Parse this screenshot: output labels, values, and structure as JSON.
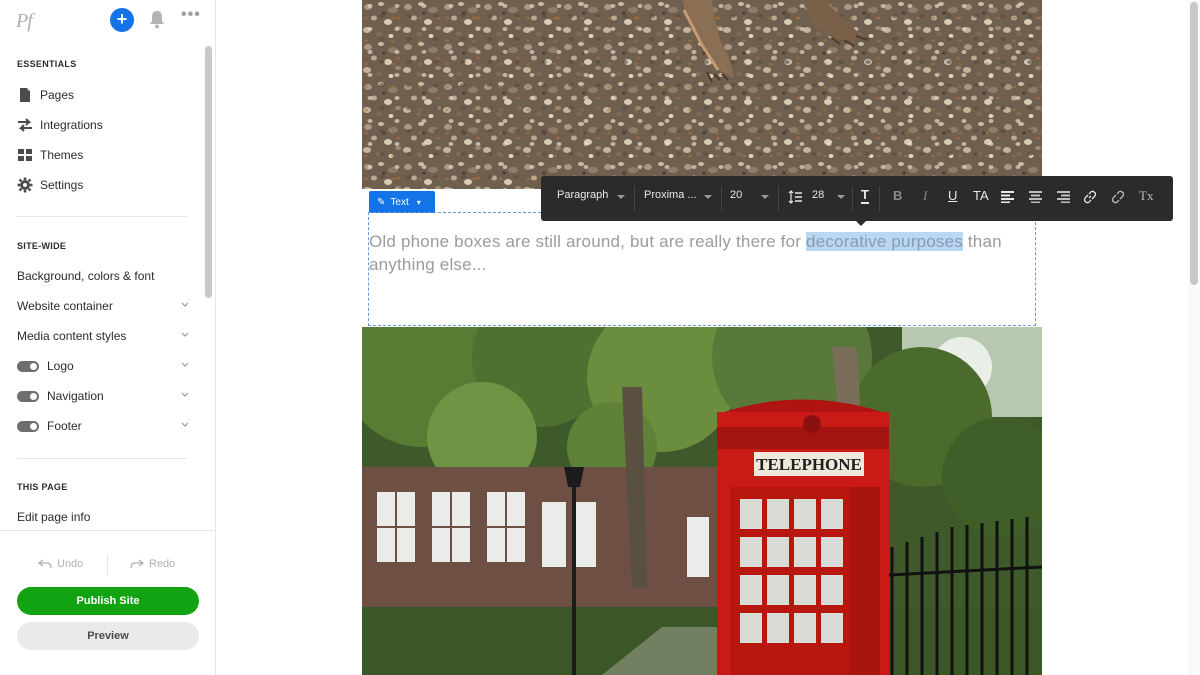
{
  "app": {
    "logo": "Pf"
  },
  "sidebar": {
    "sections": {
      "essentials": "ESSENTIALS",
      "site_wide": "SITE-WIDE",
      "this_page": "THIS PAGE"
    },
    "essentials": [
      {
        "label": "Pages",
        "icon": "page-icon"
      },
      {
        "label": "Integrations",
        "icon": "arrows-icon"
      },
      {
        "label": "Themes",
        "icon": "grid-icon"
      },
      {
        "label": "Settings",
        "icon": "gear-icon"
      }
    ],
    "site_wide": [
      {
        "label": "Background, colors & font"
      },
      {
        "label": "Website container"
      },
      {
        "label": "Media content styles"
      },
      {
        "label": "Logo",
        "toggle": "on"
      },
      {
        "label": "Navigation",
        "toggle": "on"
      },
      {
        "label": "Footer",
        "toggle": "on"
      }
    ],
    "this_page": [
      {
        "label": "Edit page info"
      }
    ],
    "undo": "Undo",
    "redo": "Redo",
    "publish": "Publish Site",
    "preview": "Preview"
  },
  "editor": {
    "block_tag": "Text",
    "body_plain_1": "Old phone boxes are still around, but are really there for ",
    "body_selected": "decorative purposes",
    "body_plain_2": " than anything else...",
    "sign_text": "TELEPHONE"
  },
  "toolbar": {
    "style": "Paragraph",
    "font": "Proxima ...",
    "size": "20",
    "line_height": "28",
    "italic_label": "I",
    "bold_label": "B",
    "underline_label": "U",
    "ta_label": "TA",
    "text_color_label": "T",
    "clear_label": "Tx"
  },
  "colors": {
    "accent": "#1473e6",
    "publish": "#12a312",
    "toolbar_bg": "#2b2b2b",
    "phonebox": "#d41f1a"
  }
}
